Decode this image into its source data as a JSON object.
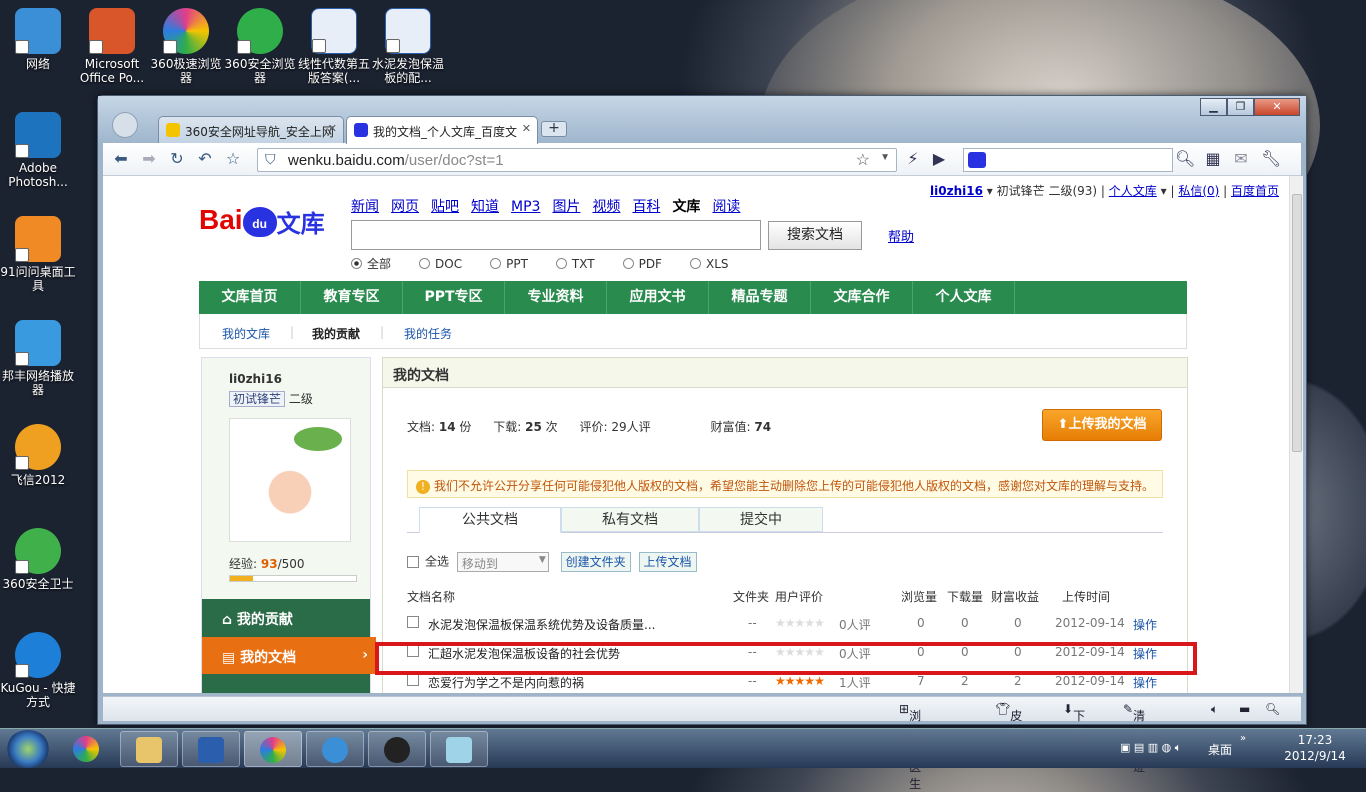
{
  "desktop": {
    "icons": [
      {
        "label": "网络",
        "color": "#3a8fd6"
      },
      {
        "label": "Microsoft Office Po...",
        "color": "#d8562a"
      },
      {
        "label": "360极速浏览器",
        "color": "#e23d8a"
      },
      {
        "label": "360安全浏览器",
        "color": "#2fae4a"
      },
      {
        "label": "线性代数第五版答案(...",
        "color": "#2b5fae"
      },
      {
        "label": "水泥发泡保温板的配...",
        "color": "#2b5fae"
      },
      {
        "label": "Adobe Photosh...",
        "color": "#1e73be"
      },
      {
        "label": "91问问桌面工具",
        "color": "#f08a24"
      },
      {
        "label": "邦丰网络播放器",
        "color": "#3a9ae0"
      },
      {
        "label": "飞信2012",
        "color": "#f0a020"
      },
      {
        "label": "360安全卫士",
        "color": "#3fb04a"
      },
      {
        "label": "KuGou - 快捷方式",
        "color": "#1d7fd8"
      }
    ]
  },
  "browser": {
    "tabs": [
      {
        "title": "360安全网址导航_安全上网"
      },
      {
        "title": "我的文档_个人文库_百度文"
      }
    ],
    "address": {
      "domain": "wenku.baidu.com",
      "path": "/user/doc?st=1"
    },
    "status": {
      "doctor": "浏览器医生",
      "skin": "皮肤",
      "download": "下载",
      "clear": "清除痕迹"
    }
  },
  "page": {
    "user": {
      "name": "li0zhi16",
      "rank": "初试锋芒",
      "level": "二级(93)",
      "library": "个人文库",
      "msg": "私信(0)",
      "home": "百度首页"
    },
    "nav": [
      "新闻",
      "网页",
      "贴吧",
      "知道",
      "MP3",
      "图片",
      "视频",
      "百科",
      "文库",
      "阅读"
    ],
    "search_btn": "搜索文档",
    "help": "帮助",
    "types": [
      "全部",
      "DOC",
      "PPT",
      "TXT",
      "PDF",
      "XLS"
    ],
    "menu": [
      "文库首页",
      "教育专区",
      "PPT专区",
      "专业资料",
      "应用文书",
      "精品专题",
      "文库合作",
      "个人文库"
    ],
    "sub": [
      "我的文库",
      "我的贡献",
      "我的任务"
    ],
    "side": {
      "name": "li0zhi16",
      "rank": "初试锋芒",
      "level": "二级",
      "exp_label": "经验:",
      "exp": "93",
      "exp_max": "/500",
      "exp_fraction": 0.186,
      "contrib": "我的贡献",
      "mydoc": "我的文档"
    },
    "main": {
      "title": "我的文档",
      "stats": {
        "docs_label": "文档:",
        "docs": "14",
        "docs_unit": "份",
        "dl_label": "下载:",
        "dl": "25",
        "dl_unit": "次",
        "rate_label": "评价:",
        "rate": "29人评",
        "wealth_label": "财富值:",
        "wealth": "74"
      },
      "upload": "上传我的文档",
      "notice": "我们不允许公开分享任何可能侵犯他人版权的文档，希望您能主动删除您上传的可能侵犯他人版权的文档，感谢您对文库的理解与支持。",
      "tabs": [
        "公共文档",
        "私有文档",
        "提交中"
      ],
      "selectall": "全选",
      "moveto": "移动到",
      "newfolder": "创建文件夹",
      "uploaddoc": "上传文档",
      "cols": [
        "文档名称",
        "文件夹",
        "用户评价",
        "浏览量",
        "下载量",
        "财富收益",
        "上传时间"
      ],
      "rows": [
        {
          "name": "水泥发泡保温板保温系统优势及设备质量...",
          "folder": "--",
          "rating": 0,
          "rcount": "0人评",
          "views": "0",
          "dls": "0",
          "wealth": "0",
          "date": "2012-09-14",
          "op": "操作"
        },
        {
          "name": "汇超水泥发泡保温板设备的社会优势",
          "folder": "--",
          "rating": 0,
          "rcount": "0人评",
          "views": "0",
          "dls": "0",
          "wealth": "0",
          "date": "2012-09-14",
          "op": "操作"
        },
        {
          "name": "恋爱行为学之不是内向惹的祸",
          "folder": "--",
          "rating": 5,
          "rcount": "1人评",
          "views": "7",
          "dls": "2",
          "wealth": "2",
          "date": "2012-09-14",
          "op": "操作"
        }
      ]
    }
  },
  "taskbar": {
    "desktop": "桌面",
    "time": "17:23",
    "date": "2012/9/14"
  }
}
